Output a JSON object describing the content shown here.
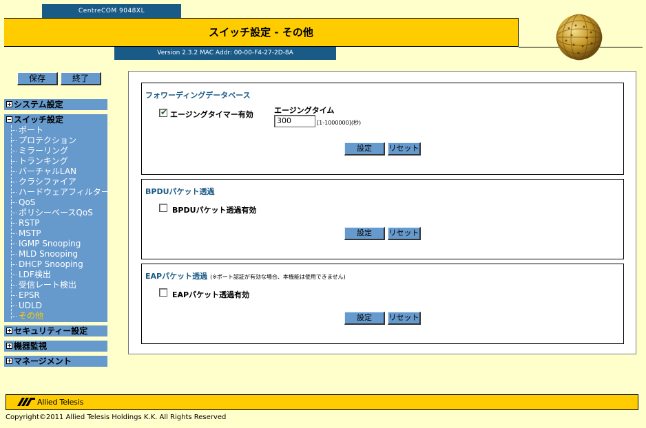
{
  "header": {
    "model": "CentreCOM 9048XL",
    "title": "スイッチ設定 - その他",
    "version_info": "Version 2.3.2 MAC Addr: 00-00-F4-27-2D-8A",
    "globe_icon": "globe-logo-icon"
  },
  "toolbar": {
    "save_label": "保存",
    "quit_label": "終了"
  },
  "nav": {
    "system": "システム設定",
    "switch": "スイッチ設定",
    "switch_items": [
      "ポート",
      "プロテクション",
      "ミラーリング",
      "トランキング",
      "バーチャルLAN",
      "クラシファイア",
      "ハードウェアフィルター",
      "QoS",
      "ポリシーベースQoS",
      "RSTP",
      "MSTP",
      "IGMP Snooping",
      "MLD Snooping",
      "DHCP Snooping",
      "LDF検出",
      "受信レート検出",
      "EPSR",
      "UDLD",
      "その他"
    ],
    "active_item": "その他",
    "security": "セキュリティー設定",
    "monitor": "機器監視",
    "management": "マネージメント"
  },
  "fdb": {
    "title": "フォワーディングデータベース",
    "aging_enable_label": "エージングタイマー有効",
    "aging_enable_checked": true,
    "aging_time_label": "エージングタイム",
    "aging_time_value": "300",
    "aging_time_range": "[1-1000000](秒)",
    "set_label": "設定",
    "reset_label": "リセット"
  },
  "bpdu": {
    "title": "BPDUパケット透過",
    "enable_label": "BPDUパケット透過有効",
    "enable_checked": false,
    "set_label": "設定",
    "reset_label": "リセット"
  },
  "eap": {
    "title": "EAPパケット透過",
    "note": "(※ポート認証が有効な場合、本機能は使用できません)",
    "enable_label": "EAPパケット透過有効",
    "enable_checked": false,
    "set_label": "設定",
    "reset_label": "リセット"
  },
  "footer": {
    "logo_text": "Allied Telesis",
    "copyright": "Copyright©2011 Allied Telesis Holdings K.K. All Rights Reserved"
  },
  "colors": {
    "page_bg": "#ffffcc",
    "accent_yellow": "#ffcc00",
    "nav_blue": "#6699cc",
    "dark_blue": "#1a5a86",
    "active_nav": "#ffcc00"
  }
}
